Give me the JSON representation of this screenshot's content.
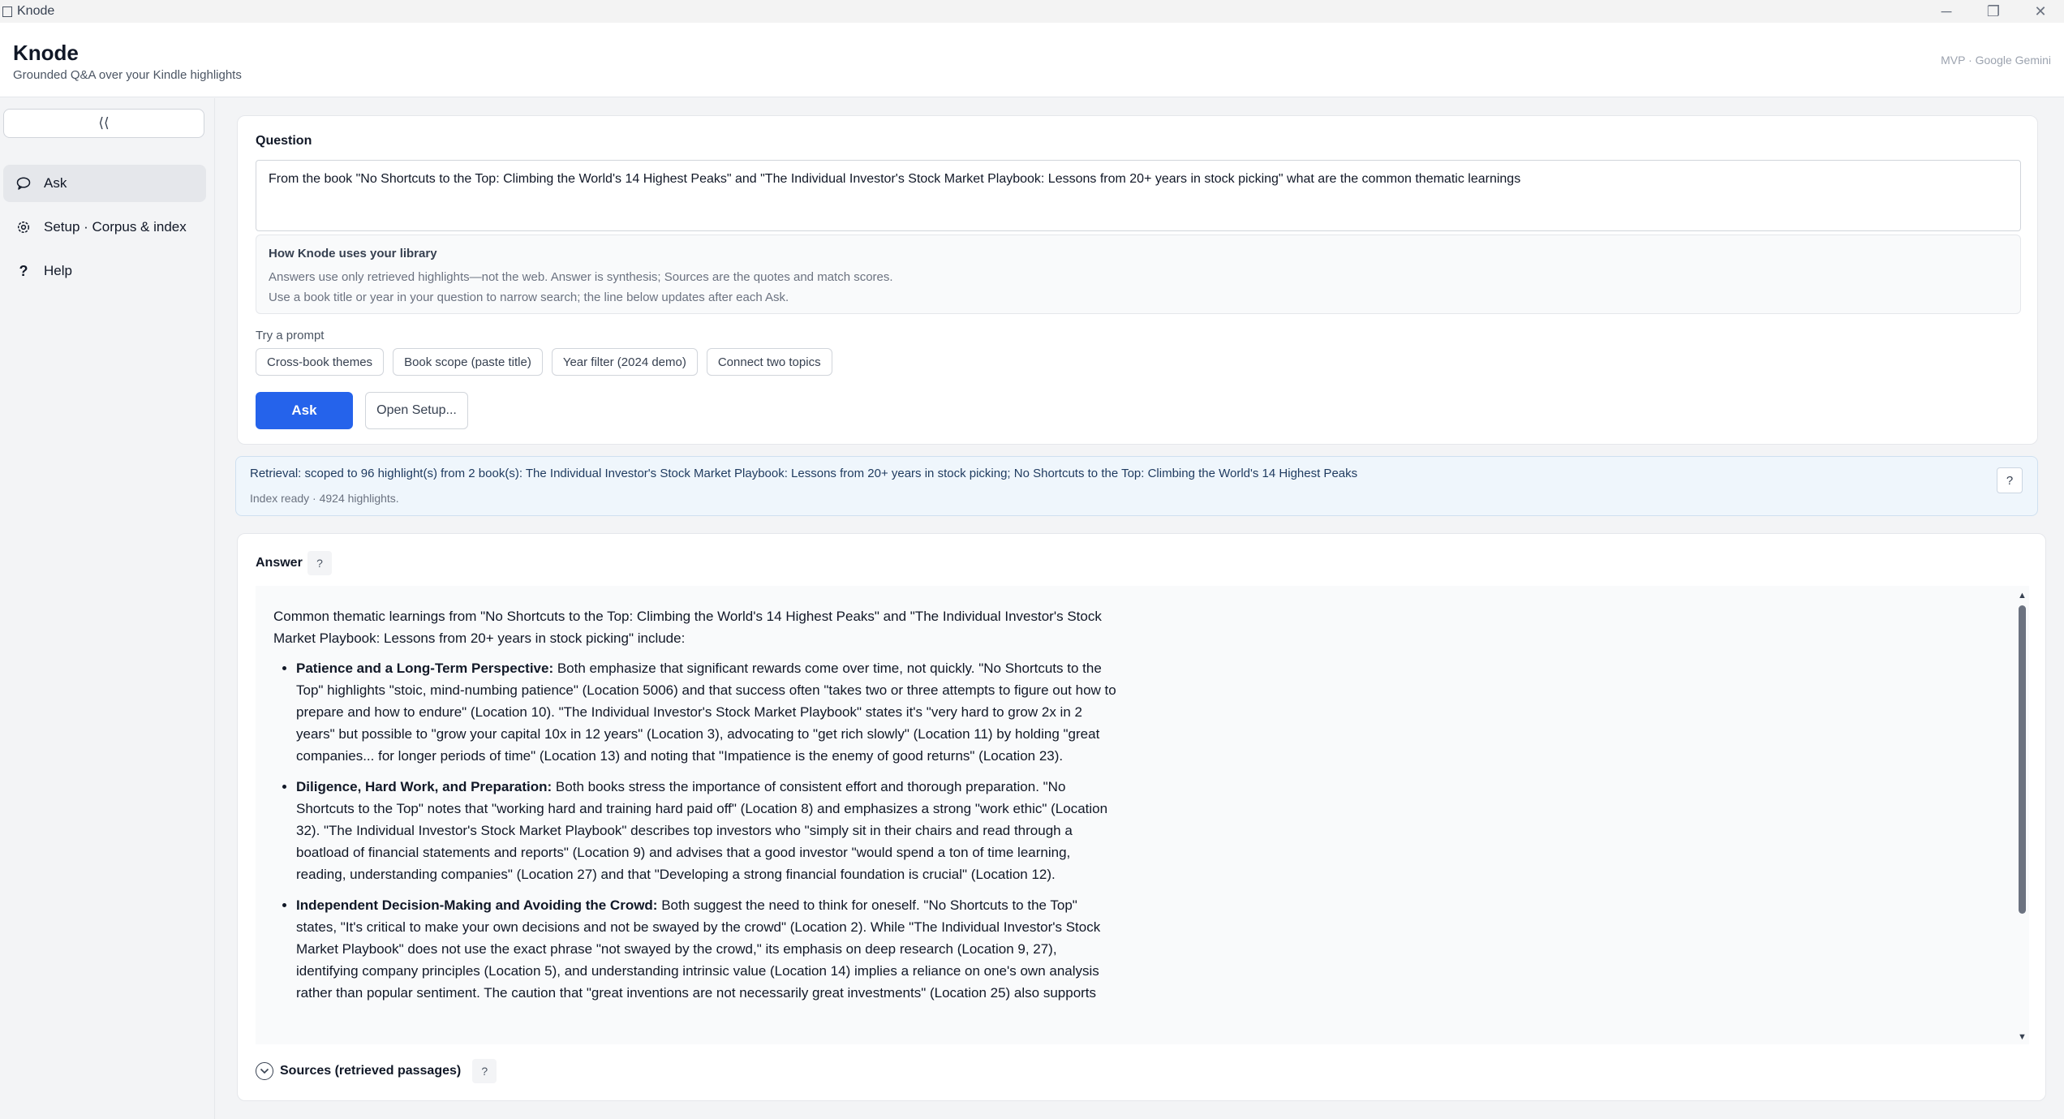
{
  "window": {
    "title": "Knode",
    "minimize": "─",
    "restore": "❐",
    "close": "✕"
  },
  "header": {
    "brand": "Knode",
    "tagline": "Grounded Q&A over your Kindle highlights",
    "provider": "MVP · Google Gemini"
  },
  "sidebar": {
    "collapse_label": "⟨⟨",
    "items": [
      {
        "label": "Ask",
        "icon": "chat-bubble-icon",
        "active": true
      },
      {
        "label": "Setup · Corpus & index",
        "icon": "gear-icon",
        "active": false
      },
      {
        "label": "Help",
        "icon": "question-icon",
        "active": false
      }
    ]
  },
  "question": {
    "label": "Question",
    "value": "From the book \"No Shortcuts to the Top: Climbing the World's 14 Highest Peaks\" and \"The Individual Investor's Stock Market Playbook: Lessons from 20+ years in stock picking\" what are the common thematic learnings",
    "how_title": "How Knode uses your library",
    "how_line1": "Answers use only retrieved highlights—not the web. Answer is synthesis; Sources are the quotes and match scores.",
    "how_line2": "Use a book title or year in your question to narrow search; the line below updates after each Ask.",
    "try_label": "Try a prompt",
    "chips": [
      "Cross-book themes",
      "Book scope (paste title)",
      "Year filter (2024 demo)",
      "Connect two topics"
    ],
    "ask_label": "Ask",
    "setup_label": "Open Setup..."
  },
  "retrieval": {
    "text": "Retrieval: scoped to 96 highlight(s) from 2 book(s): The Individual Investor's Stock Market Playbook: Lessons from 20+ years in stock picking; No Shortcuts to the Top: Climbing the World's 14 Highest Peaks",
    "status": "Index ready · 4924 highlights.",
    "help": "?"
  },
  "answer": {
    "label": "Answer",
    "help": "?",
    "intro": "Common thematic learnings from \"No Shortcuts to the Top: Climbing the World's 14 Highest Peaks\" and \"The Individual Investor's Stock Market Playbook: Lessons from 20+ years in stock picking\" include:",
    "bullets": [
      {
        "title": "Patience and a Long-Term Perspective:",
        "body": " Both emphasize that significant rewards come over time, not quickly. \"No Shortcuts to the Top\" highlights \"stoic, mind-numbing patience\" (Location 5006) and that success often \"takes two or three attempts to figure out how to prepare and how to endure\" (Location 10). \"The Individual Investor's Stock Market Playbook\" states it's \"very hard to grow 2x in 2 years\" but possible to \"grow your capital 10x in 12 years\" (Location 3), advocating to \"get rich slowly\" (Location 11) by holding \"great companies... for longer periods of time\" (Location 13) and noting that \"Impatience is the enemy of good returns\" (Location 23)."
      },
      {
        "title": "Diligence, Hard Work, and Preparation:",
        "body": " Both books stress the importance of consistent effort and thorough preparation. \"No Shortcuts to the Top\" notes that \"working hard and training hard paid off\" (Location 8) and emphasizes a strong \"work ethic\" (Location 32). \"The Individual Investor's Stock Market Playbook\" describes top investors who \"simply sit in their chairs and read through a boatload of financial statements and reports\" (Location 9) and advises that a good investor \"would spend a ton of time learning, reading, understanding companies\" (Location 27) and that \"Developing a strong financial foundation is crucial\" (Location 12)."
      },
      {
        "title": "Independent Decision-Making and Avoiding the Crowd:",
        "body": " Both suggest the need to think for oneself. \"No Shortcuts to the Top\" states, \"It's critical to make your own decisions and not be swayed by the crowd\" (Location 2). While \"The Individual Investor's Stock Market Playbook\" does not use the exact phrase \"not swayed by the crowd,\" its emphasis on deep research (Location 9, 27), identifying company principles (Location 5), and understanding intrinsic value (Location 14) implies a reliance on one's own analysis rather than popular sentiment. The caution that \"great inventions are not necessarily great investments\" (Location 25) also supports"
      }
    ],
    "sources_label": "Sources (retrieved passages)",
    "sources_help": "?"
  },
  "colors": {
    "accent": "#2563eb",
    "retrieval_bg": "#eff6fc"
  }
}
